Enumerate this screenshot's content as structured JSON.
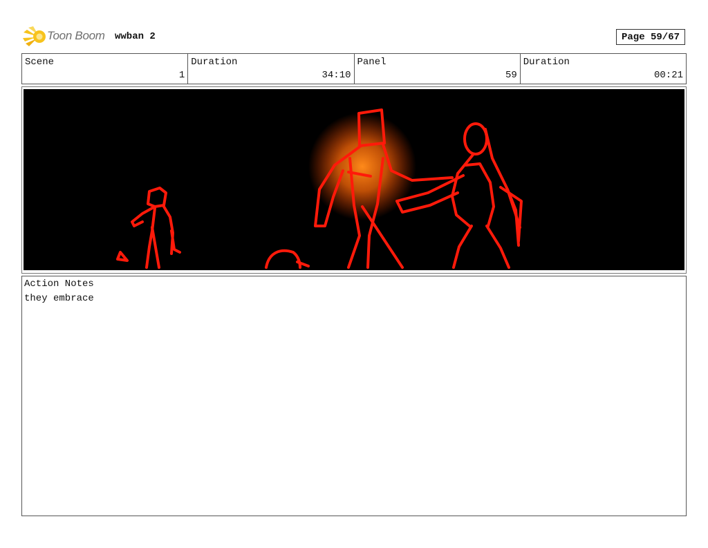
{
  "header": {
    "logo_text": "Toon Boom",
    "project_title": "wwban 2",
    "page_label": "Page 59/67"
  },
  "info": {
    "scene_label": "Scene",
    "scene_value": "1",
    "duration_label": "Duration",
    "duration_value": "34:10",
    "panel_label": "Panel",
    "panel_value": "59",
    "panel_duration_label": "Duration",
    "panel_duration_value": "00:21"
  },
  "notes": {
    "label": "Action Notes",
    "text": "they embrace"
  },
  "colors": {
    "sketch_red": "#ff1a0a",
    "glow_orange": "#ff7a10",
    "panel_background": "#000000",
    "logo_yellow": "#f7c31c"
  }
}
